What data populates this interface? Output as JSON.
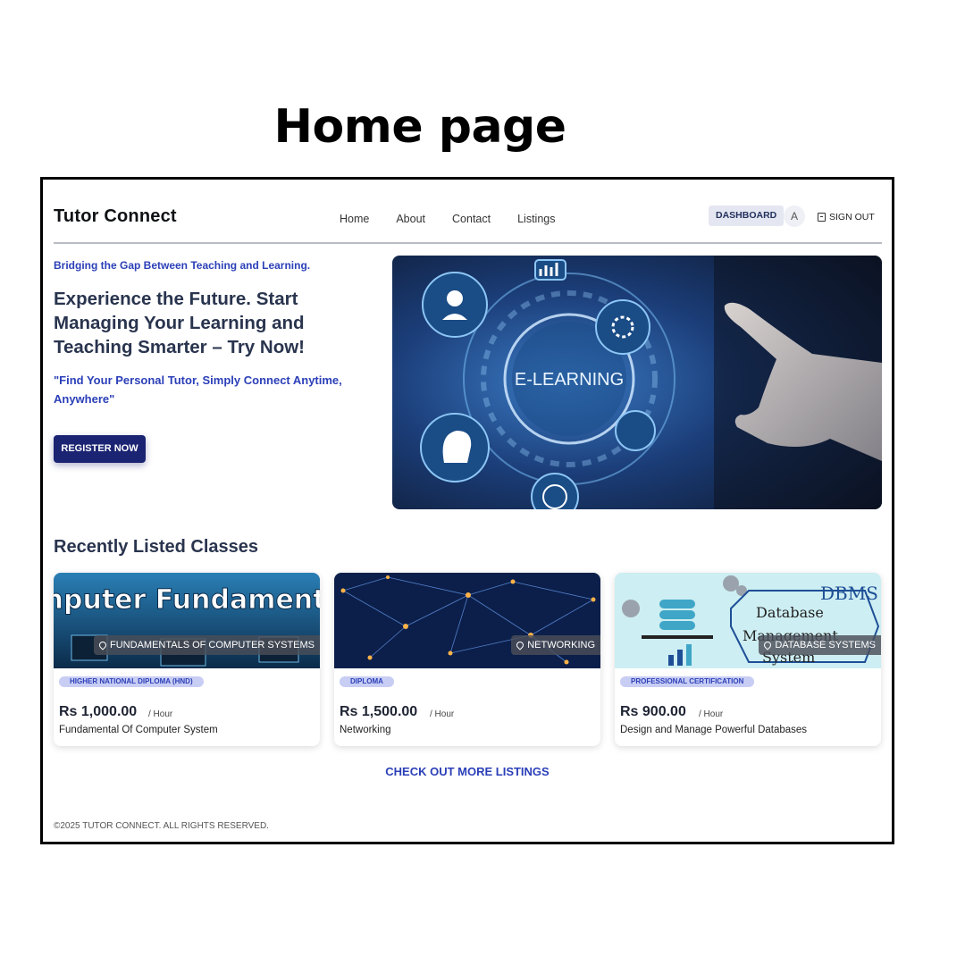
{
  "caption": "Home page",
  "header": {
    "brand": "Tutor Connect",
    "nav": [
      "Home",
      "About",
      "Contact",
      "Listings"
    ],
    "dashboard_label": "DASHBOARD",
    "avatar_initial": "A",
    "signout_label": "SIGN OUT"
  },
  "hero": {
    "tagline": "Bridging the Gap Between Teaching and Learning.",
    "headline": "Experience the Future. Start Managing Your Learning and Teaching Smarter – Try Now!",
    "quote": "\"Find Your Personal Tutor, Simply Connect Anytime, Anywhere\"",
    "register_label": "REGISTER NOW",
    "image_text": "E-LEARNING"
  },
  "recent": {
    "title": "Recently Listed Classes",
    "cards": [
      {
        "category": "FUNDAMENTALS OF COMPUTER SYSTEMS",
        "badge": "HIGHER NATIONAL DIPLOMA (HND)",
        "price": "Rs 1,000.00",
        "per": "/ Hour",
        "name": "Fundamental Of Computer System",
        "thumb_text": "Computer Fundamentals"
      },
      {
        "category": "NETWORKING",
        "badge": "DIPLOMA",
        "price": "Rs 1,500.00",
        "per": "/ Hour",
        "name": "Networking"
      },
      {
        "category": "DATABASE SYSTEMS",
        "badge": "PROFESSIONAL CERTIFICATION",
        "price": "Rs 900.00",
        "per": "/ Hour",
        "name": "Design and Manage Powerful Databases",
        "thumb_text": [
          "DBMS",
          "Database",
          "Management",
          "System"
        ]
      }
    ],
    "more_label": "CHECK OUT MORE LISTINGS"
  },
  "footer": "©2025 TUTOR CONNECT. ALL RIGHTS RESERVED.",
  "colors": {
    "accent": "#2b3fb8",
    "primary_button": "#1b2472",
    "heading": "#29344e",
    "badge_bg": "#c8cdf4"
  }
}
